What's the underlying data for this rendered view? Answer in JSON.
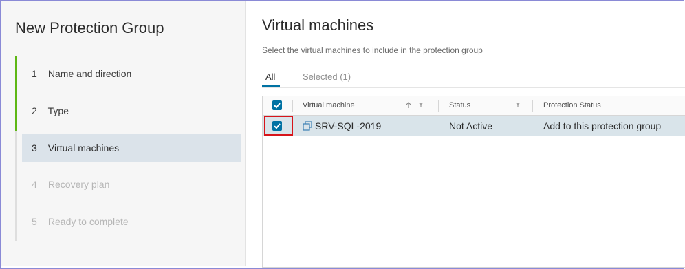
{
  "wizard": {
    "title": "New Protection Group",
    "steps": [
      {
        "num": "1",
        "label": "Name and direction",
        "state": "done"
      },
      {
        "num": "2",
        "label": "Type",
        "state": "done"
      },
      {
        "num": "3",
        "label": "Virtual machines",
        "state": "active"
      },
      {
        "num": "4",
        "label": "Recovery plan",
        "state": "pending"
      },
      {
        "num": "5",
        "label": "Ready to complete",
        "state": "pending"
      }
    ]
  },
  "main": {
    "title": "Virtual machines",
    "description": "Select the virtual machines to include in the protection group",
    "tabs": [
      {
        "label": "All",
        "active": true
      },
      {
        "label": "Selected (1)",
        "active": false
      }
    ],
    "table": {
      "columns": [
        "Virtual machine",
        "Status",
        "Protection Status"
      ],
      "header_checked": true,
      "rows": [
        {
          "checked": true,
          "icon": "vm-icon",
          "name": "SRV-SQL-2019",
          "status": "Not Active",
          "protection_status": "Add to this protection group"
        }
      ]
    }
  },
  "colors": {
    "accent": "#0072a3",
    "progress": "#5eb715",
    "selected_row": "#d9e4ea",
    "highlight_box": "#d7141a"
  }
}
